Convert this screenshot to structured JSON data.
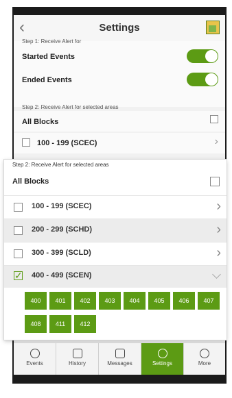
{
  "header": {
    "title": "Settings",
    "back_icon": "chevron-left-icon",
    "logo_icon": "app-logo-icon"
  },
  "step1": {
    "label": "Step 1: Receive Alert for",
    "items": [
      {
        "label": "Started Events",
        "on": true
      },
      {
        "label": "Ended Events",
        "on": true
      }
    ]
  },
  "step2_bg": {
    "label": "Step 2: Receive Alert for selected areas",
    "all_label": "All Blocks",
    "row_label": "100 - 199 (SCEC)"
  },
  "popup": {
    "step_label": "Step 2: Receive Alert for selected areas",
    "all_label": "All Blocks",
    "rows": [
      {
        "label": "100 - 199 (SCEC)",
        "checked": false
      },
      {
        "label": "200 - 299 (SCHD)",
        "checked": false
      },
      {
        "label": "300 - 399 (SCLD)",
        "checked": false
      },
      {
        "label": "400 - 499 (SCEN)",
        "checked": true
      }
    ],
    "blocks": [
      "400",
      "401",
      "402",
      "403",
      "404",
      "405",
      "406",
      "407",
      "408",
      "411",
      "412"
    ]
  },
  "tabs": [
    {
      "label": "Events",
      "icon": "clock-icon"
    },
    {
      "label": "History",
      "icon": "history-icon"
    },
    {
      "label": "Messages",
      "icon": "envelope-icon"
    },
    {
      "label": "Settings",
      "icon": "gear-icon",
      "active": true
    },
    {
      "label": "More",
      "icon": "more-icon"
    }
  ],
  "colors": {
    "accent": "#5c9b14"
  }
}
